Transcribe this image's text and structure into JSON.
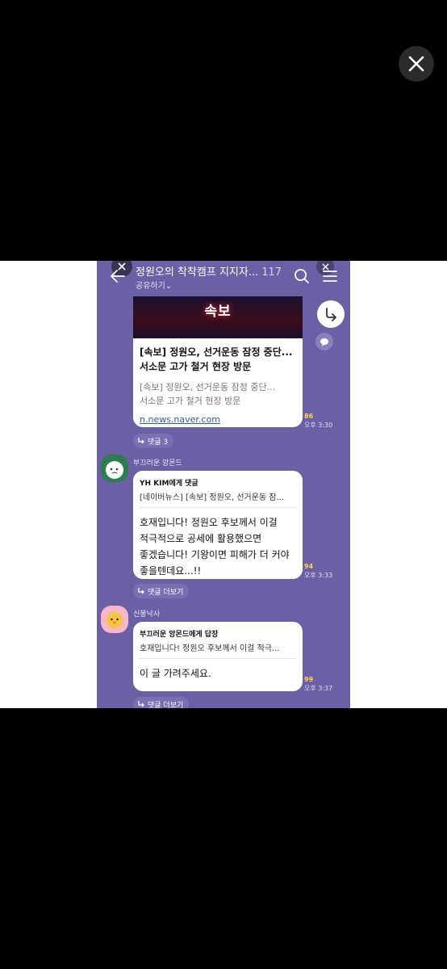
{
  "chat": {
    "title": "정원오의 착착캠프 지지자...",
    "member_count": "117",
    "share_label": "공유하기",
    "share_chevron": "⌄"
  },
  "news": {
    "image_text": "속보",
    "title_lines": [
      "[속보] 정원오, 선거운동 잠정 중단...",
      "서소문 고가 철거 현장 방문"
    ],
    "desc_lines": [
      "[속보] 정원오, 선거운동 잠정 중단...",
      "서소문 고가 철거 현장 방문"
    ],
    "link": "n.news.naver.com",
    "read_count": "86",
    "time": "오후 3:30",
    "reply_label": "댓글 3"
  },
  "msg1": {
    "sender": "부끄러운 앙몬드",
    "quote_header": "YH KIM에게 댓글",
    "quote_snippet": "[네이버뉴스] [속보] 정원오, 선거운동 잠...",
    "body_lines": [
      "호재입니다! 정원오 후보께서 이걸",
      "적극적으로 공세에 활용했으면",
      "좋겠습니다! 기왕이면 피해가 더 커야",
      "좋을텐데요...!!"
    ],
    "read_count": "94",
    "time": "오후 3:33",
    "reply_label": "댓글 더보기"
  },
  "msg2": {
    "sender": "신봉낙사",
    "quote_header": "부끄러운 앙몬드에게 답장",
    "quote_snippet": "호재입니다! 정원오 후보께서 이걸 적극...",
    "body": "이 글 가려주세요.",
    "read_count": "99",
    "time": "오후 3:37",
    "reply_label": "댓글 더보기"
  },
  "colors": {
    "chat_bg": "#6b5fa6",
    "read_count": "#ffd54a",
    "link": "#2a62a8"
  },
  "icons": [
    "close-icon",
    "back-arrow-icon",
    "search-icon",
    "menu-icon",
    "share-arrow-icon",
    "speech-bubble-icon",
    "reply-arrow-icon"
  ]
}
